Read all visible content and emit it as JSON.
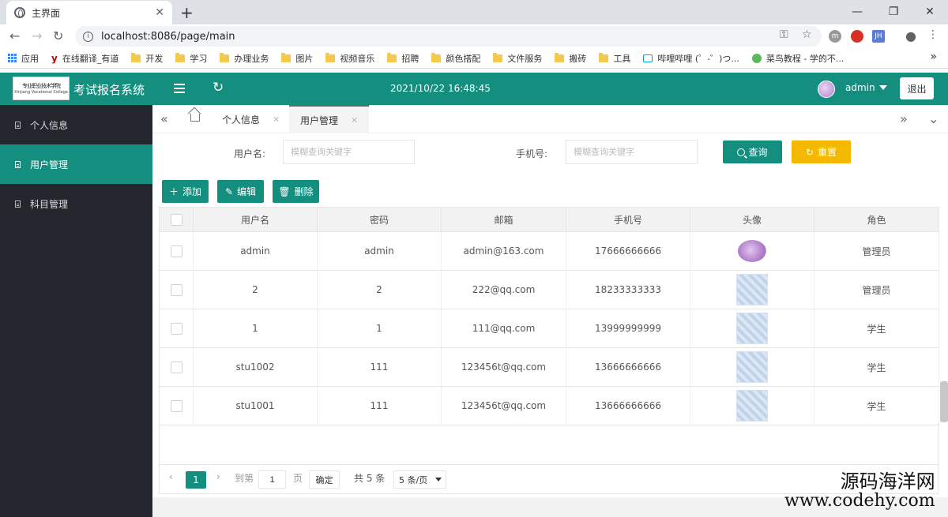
{
  "browser": {
    "tab_title": "主界面",
    "url": "localhost:8086/page/main",
    "bookmarks": [
      "应用",
      "在线翻译_有道",
      "开发",
      "学习",
      "办理业务",
      "图片",
      "视频音乐",
      "招聘",
      "颜色搭配",
      "文件服务",
      "搬砖",
      "工具",
      "哔哩哔哩 (゜-゜)つ...",
      "菜鸟教程 - 学的不..."
    ],
    "extensions": [
      "m",
      "JH"
    ]
  },
  "header": {
    "logo_line1": "专业职业技术学院",
    "logo_line2": "Xinjiang Vocational College",
    "app_title": "考试报名系统",
    "datetime": "2021/10/22 16:48:45",
    "username": "admin",
    "logout": "退出"
  },
  "sidebar": {
    "items": [
      {
        "label": "个人信息",
        "active": false
      },
      {
        "label": "用户管理",
        "active": true
      },
      {
        "label": "科目管理",
        "active": false
      }
    ]
  },
  "tabs": [
    {
      "label": "个人信息",
      "active": false
    },
    {
      "label": "用户管理",
      "active": true
    }
  ],
  "search": {
    "username_label": "用户名:",
    "username_placeholder": "模糊查询关键字",
    "phone_label": "手机号:",
    "phone_placeholder": "模糊查询关键字",
    "query_button": "查询",
    "reset_button": "重置"
  },
  "toolbar": {
    "add": "添加",
    "edit": "编辑",
    "delete": "删除"
  },
  "table": {
    "columns": [
      "用户名",
      "密码",
      "邮箱",
      "手机号",
      "头像",
      "角色"
    ],
    "rows": [
      {
        "username": "admin",
        "password": "admin",
        "email": "admin@163.com",
        "phone": "17666666666",
        "avatar": "purple-avatar",
        "role": "管理员"
      },
      {
        "username": "2",
        "password": "2",
        "email": "222@qq.com",
        "phone": "18233333333",
        "avatar": "qq-avatar",
        "role": "管理员"
      },
      {
        "username": "1",
        "password": "1",
        "email": "111@qq.com",
        "phone": "13999999999",
        "avatar": "qq-avatar",
        "role": "学生"
      },
      {
        "username": "stu1002",
        "password": "111",
        "email": "123456t@qq.com",
        "phone": "13666666666",
        "avatar": "qq-avatar",
        "role": "学生"
      },
      {
        "username": "stu1001",
        "password": "111",
        "email": "123456t@qq.com",
        "phone": "13666666666",
        "avatar": "qq-avatar",
        "role": "学生"
      }
    ]
  },
  "pager": {
    "current_page": "1",
    "goto_label": "到第",
    "goto_value": "1",
    "page_unit": "页",
    "confirm": "确定",
    "total": "共 5 条",
    "page_size": "5 条/页"
  },
  "watermark": {
    "line1": "源码海洋网",
    "line2": "www.codehy.com"
  },
  "colors": {
    "primary": "#148f7f",
    "warning": "#f5b800",
    "sidebar_bg": "#24262e"
  }
}
